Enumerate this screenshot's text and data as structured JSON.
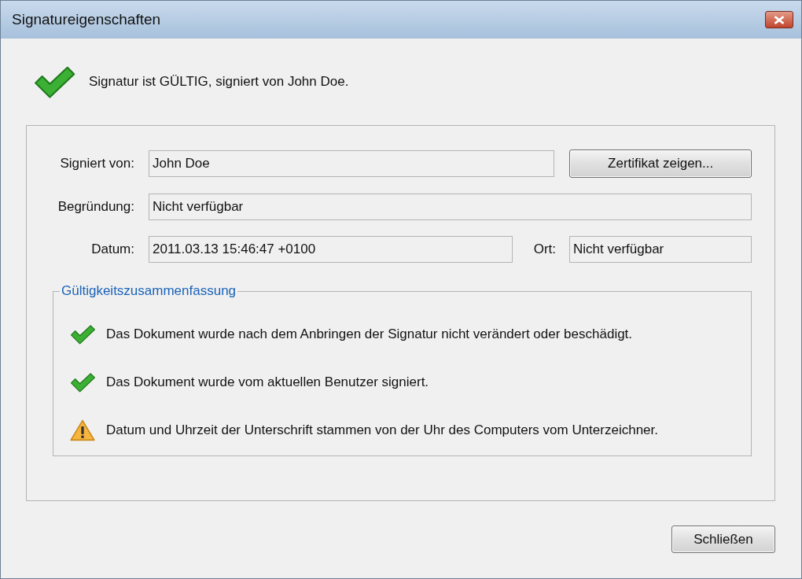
{
  "window": {
    "title": "Signatureigenschaften"
  },
  "status": {
    "kind": "valid",
    "text": "Signatur ist GÜLTIG, signiert von John Doe."
  },
  "fields": {
    "signed_by": {
      "label": "Signiert von:",
      "value": "John Doe"
    },
    "reason": {
      "label": "Begründung:",
      "value": "Nicht verfügbar"
    },
    "date": {
      "label": "Datum:",
      "value": "2011.03.13 15:46:47 +0100"
    },
    "location": {
      "label": "Ort:",
      "value": "Nicht verfügbar"
    }
  },
  "show_certificate_button": "Zertifikat zeigen...",
  "summary": {
    "title": "Gültigkeitszusammenfassung",
    "items": [
      {
        "kind": "valid",
        "text": "Das Dokument wurde nach dem Anbringen der Signatur nicht verändert oder beschädigt."
      },
      {
        "kind": "valid",
        "text": "Das Dokument wurde vom aktuellen Benutzer signiert."
      },
      {
        "kind": "warning",
        "text": "Datum und Uhrzeit der Unterschrift stammen von der Uhr des Computers vom Unterzeichner."
      }
    ]
  },
  "close_button": "Schließen"
}
